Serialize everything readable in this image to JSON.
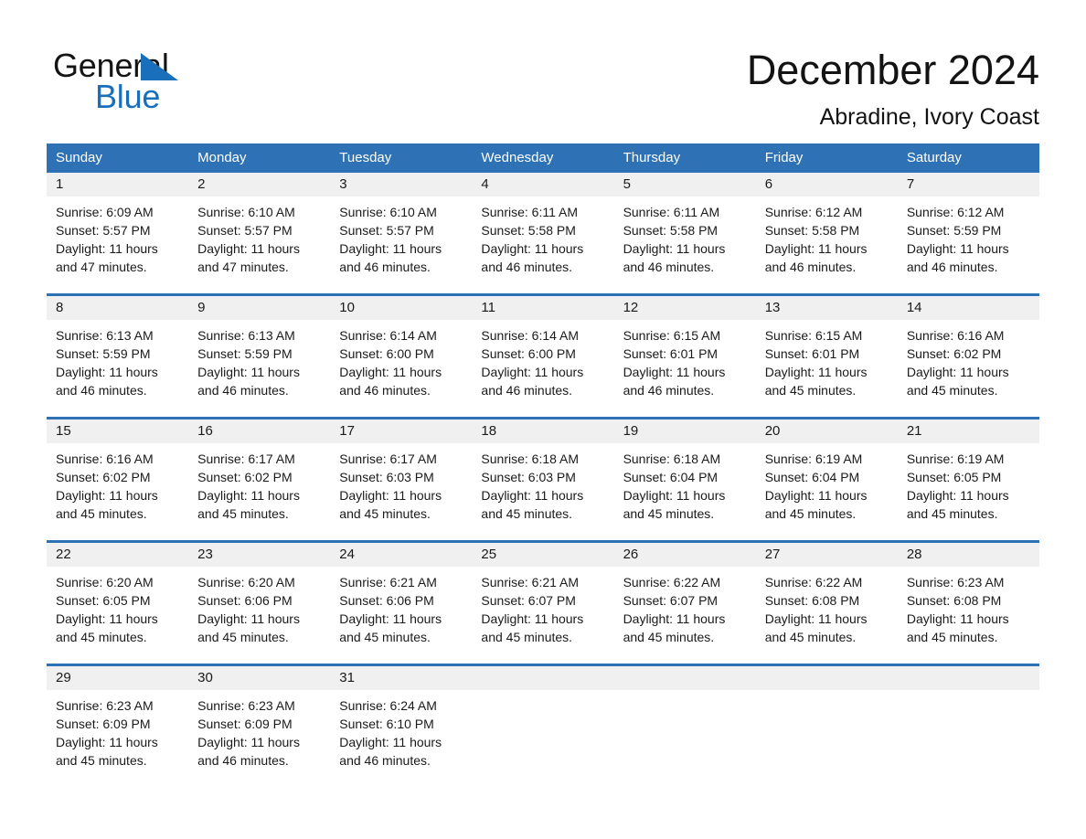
{
  "brand": {
    "name_top": "General",
    "name_bottom": "Blue",
    "accent_color": "#1a6fba"
  },
  "header": {
    "month_title": "December 2024",
    "location": "Abradine, Ivory Coast"
  },
  "theme": {
    "header_blue": "#2e72b5",
    "daynum_band": "#f0f0f0",
    "text": "#1a1a1a"
  },
  "calendar": {
    "weekdays": [
      "Sunday",
      "Monday",
      "Tuesday",
      "Wednesday",
      "Thursday",
      "Friday",
      "Saturday"
    ],
    "weeks": [
      [
        {
          "day": "1",
          "lines": [
            "Sunrise: 6:09 AM",
            "Sunset: 5:57 PM",
            "Daylight: 11 hours",
            "and 47 minutes."
          ]
        },
        {
          "day": "2",
          "lines": [
            "Sunrise: 6:10 AM",
            "Sunset: 5:57 PM",
            "Daylight: 11 hours",
            "and 47 minutes."
          ]
        },
        {
          "day": "3",
          "lines": [
            "Sunrise: 6:10 AM",
            "Sunset: 5:57 PM",
            "Daylight: 11 hours",
            "and 46 minutes."
          ]
        },
        {
          "day": "4",
          "lines": [
            "Sunrise: 6:11 AM",
            "Sunset: 5:58 PM",
            "Daylight: 11 hours",
            "and 46 minutes."
          ]
        },
        {
          "day": "5",
          "lines": [
            "Sunrise: 6:11 AM",
            "Sunset: 5:58 PM",
            "Daylight: 11 hours",
            "and 46 minutes."
          ]
        },
        {
          "day": "6",
          "lines": [
            "Sunrise: 6:12 AM",
            "Sunset: 5:58 PM",
            "Daylight: 11 hours",
            "and 46 minutes."
          ]
        },
        {
          "day": "7",
          "lines": [
            "Sunrise: 6:12 AM",
            "Sunset: 5:59 PM",
            "Daylight: 11 hours",
            "and 46 minutes."
          ]
        }
      ],
      [
        {
          "day": "8",
          "lines": [
            "Sunrise: 6:13 AM",
            "Sunset: 5:59 PM",
            "Daylight: 11 hours",
            "and 46 minutes."
          ]
        },
        {
          "day": "9",
          "lines": [
            "Sunrise: 6:13 AM",
            "Sunset: 5:59 PM",
            "Daylight: 11 hours",
            "and 46 minutes."
          ]
        },
        {
          "day": "10",
          "lines": [
            "Sunrise: 6:14 AM",
            "Sunset: 6:00 PM",
            "Daylight: 11 hours",
            "and 46 minutes."
          ]
        },
        {
          "day": "11",
          "lines": [
            "Sunrise: 6:14 AM",
            "Sunset: 6:00 PM",
            "Daylight: 11 hours",
            "and 46 minutes."
          ]
        },
        {
          "day": "12",
          "lines": [
            "Sunrise: 6:15 AM",
            "Sunset: 6:01 PM",
            "Daylight: 11 hours",
            "and 46 minutes."
          ]
        },
        {
          "day": "13",
          "lines": [
            "Sunrise: 6:15 AM",
            "Sunset: 6:01 PM",
            "Daylight: 11 hours",
            "and 45 minutes."
          ]
        },
        {
          "day": "14",
          "lines": [
            "Sunrise: 6:16 AM",
            "Sunset: 6:02 PM",
            "Daylight: 11 hours",
            "and 45 minutes."
          ]
        }
      ],
      [
        {
          "day": "15",
          "lines": [
            "Sunrise: 6:16 AM",
            "Sunset: 6:02 PM",
            "Daylight: 11 hours",
            "and 45 minutes."
          ]
        },
        {
          "day": "16",
          "lines": [
            "Sunrise: 6:17 AM",
            "Sunset: 6:02 PM",
            "Daylight: 11 hours",
            "and 45 minutes."
          ]
        },
        {
          "day": "17",
          "lines": [
            "Sunrise: 6:17 AM",
            "Sunset: 6:03 PM",
            "Daylight: 11 hours",
            "and 45 minutes."
          ]
        },
        {
          "day": "18",
          "lines": [
            "Sunrise: 6:18 AM",
            "Sunset: 6:03 PM",
            "Daylight: 11 hours",
            "and 45 minutes."
          ]
        },
        {
          "day": "19",
          "lines": [
            "Sunrise: 6:18 AM",
            "Sunset: 6:04 PM",
            "Daylight: 11 hours",
            "and 45 minutes."
          ]
        },
        {
          "day": "20",
          "lines": [
            "Sunrise: 6:19 AM",
            "Sunset: 6:04 PM",
            "Daylight: 11 hours",
            "and 45 minutes."
          ]
        },
        {
          "day": "21",
          "lines": [
            "Sunrise: 6:19 AM",
            "Sunset: 6:05 PM",
            "Daylight: 11 hours",
            "and 45 minutes."
          ]
        }
      ],
      [
        {
          "day": "22",
          "lines": [
            "Sunrise: 6:20 AM",
            "Sunset: 6:05 PM",
            "Daylight: 11 hours",
            "and 45 minutes."
          ]
        },
        {
          "day": "23",
          "lines": [
            "Sunrise: 6:20 AM",
            "Sunset: 6:06 PM",
            "Daylight: 11 hours",
            "and 45 minutes."
          ]
        },
        {
          "day": "24",
          "lines": [
            "Sunrise: 6:21 AM",
            "Sunset: 6:06 PM",
            "Daylight: 11 hours",
            "and 45 minutes."
          ]
        },
        {
          "day": "25",
          "lines": [
            "Sunrise: 6:21 AM",
            "Sunset: 6:07 PM",
            "Daylight: 11 hours",
            "and 45 minutes."
          ]
        },
        {
          "day": "26",
          "lines": [
            "Sunrise: 6:22 AM",
            "Sunset: 6:07 PM",
            "Daylight: 11 hours",
            "and 45 minutes."
          ]
        },
        {
          "day": "27",
          "lines": [
            "Sunrise: 6:22 AM",
            "Sunset: 6:08 PM",
            "Daylight: 11 hours",
            "and 45 minutes."
          ]
        },
        {
          "day": "28",
          "lines": [
            "Sunrise: 6:23 AM",
            "Sunset: 6:08 PM",
            "Daylight: 11 hours",
            "and 45 minutes."
          ]
        }
      ],
      [
        {
          "day": "29",
          "lines": [
            "Sunrise: 6:23 AM",
            "Sunset: 6:09 PM",
            "Daylight: 11 hours",
            "and 45 minutes."
          ]
        },
        {
          "day": "30",
          "lines": [
            "Sunrise: 6:23 AM",
            "Sunset: 6:09 PM",
            "Daylight: 11 hours",
            "and 46 minutes."
          ]
        },
        {
          "day": "31",
          "lines": [
            "Sunrise: 6:24 AM",
            "Sunset: 6:10 PM",
            "Daylight: 11 hours",
            "and 46 minutes."
          ]
        },
        {
          "day": "",
          "lines": []
        },
        {
          "day": "",
          "lines": []
        },
        {
          "day": "",
          "lines": []
        },
        {
          "day": "",
          "lines": []
        }
      ]
    ]
  }
}
